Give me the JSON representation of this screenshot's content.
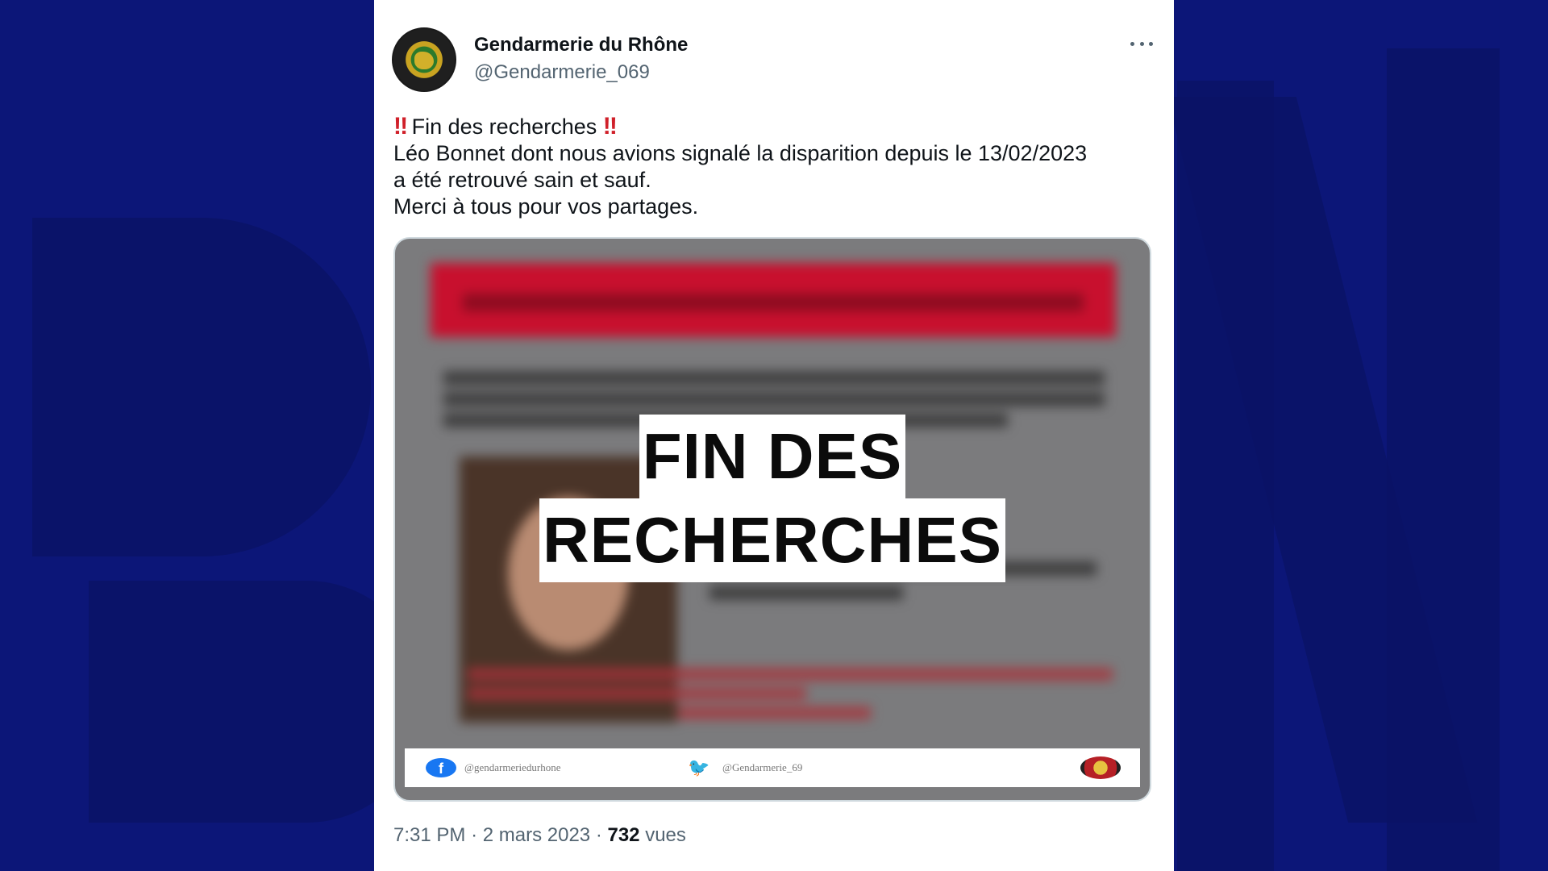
{
  "tweet": {
    "author_name": "Gendarmerie du Rhône",
    "author_handle": "@Gendarmerie_069",
    "text_line1": "Fin des recherches",
    "text_line2": "Léo Bonnet dont nous avions signalé la disparition depuis le 13/02/2023",
    "text_line3": "a été retrouvé sain et sauf.",
    "text_line4": "Merci à tous pour vos partages.",
    "emoji_double_exclamation": "‼",
    "time": "7:31 PM",
    "separator": "·",
    "date": "2 mars 2023",
    "views_count": "732",
    "views_label": "vues"
  },
  "media": {
    "overlay_line1": "FIN DES",
    "overlay_line2": "RECHERCHES",
    "footer_facebook": "@gendarmeriedurhone",
    "footer_twitter": "@Gendarmerie_69"
  },
  "icons": {
    "more": "more-horizontal-icon",
    "facebook": "facebook-icon",
    "twitter": "twitter-bird-icon",
    "emblem": "gendarmerie-emblem-icon"
  },
  "colors": {
    "background": "#0c1678",
    "card": "#ffffff",
    "text_primary": "#0f1419",
    "text_secondary": "#536471",
    "emoji_red": "#d0202a",
    "poster_red": "#c8102e"
  }
}
